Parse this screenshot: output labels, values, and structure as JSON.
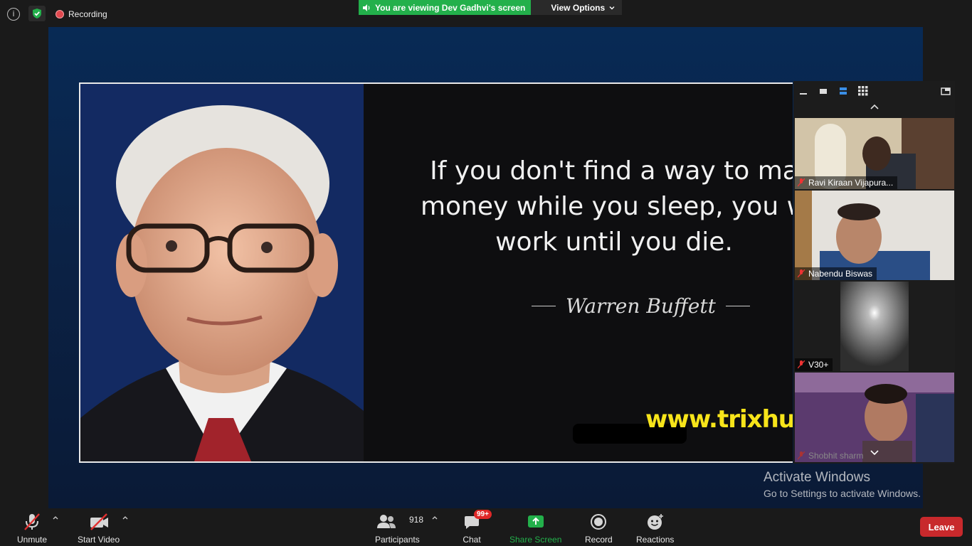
{
  "topbar": {
    "info_icon": "i",
    "recording_label": "Recording",
    "viewing_text": "You are viewing Dev Gadhvi's screen",
    "view_options_label": "View Options"
  },
  "slide": {
    "quote_lines": [
      "If you don't find a way to ma",
      "money while you sleep, you w",
      "work until you die."
    ],
    "author": "Warren Buffett",
    "website": "www.trixhub.c"
  },
  "gallery": {
    "participants": [
      {
        "name": "Ravi Kiraan Vijapura..."
      },
      {
        "name": "Nabendu Biswas"
      },
      {
        "name": "V30+"
      },
      {
        "name": "Shobhit sharm"
      }
    ]
  },
  "watermark": {
    "title": "Activate Windows",
    "subtitle": "Go to Settings to activate Windows."
  },
  "toolbar": {
    "unmute": "Unmute",
    "start_video": "Start Video",
    "participants": "Participants",
    "participant_count": "918",
    "chat": "Chat",
    "chat_badge": "99+",
    "share_screen": "Share Screen",
    "record": "Record",
    "reactions": "Reactions",
    "leave": "Leave"
  },
  "colors": {
    "share_green": "#23b04b",
    "leave_red": "#c8292c",
    "badge_red": "#e02828",
    "website_yellow": "#f7e41a"
  }
}
